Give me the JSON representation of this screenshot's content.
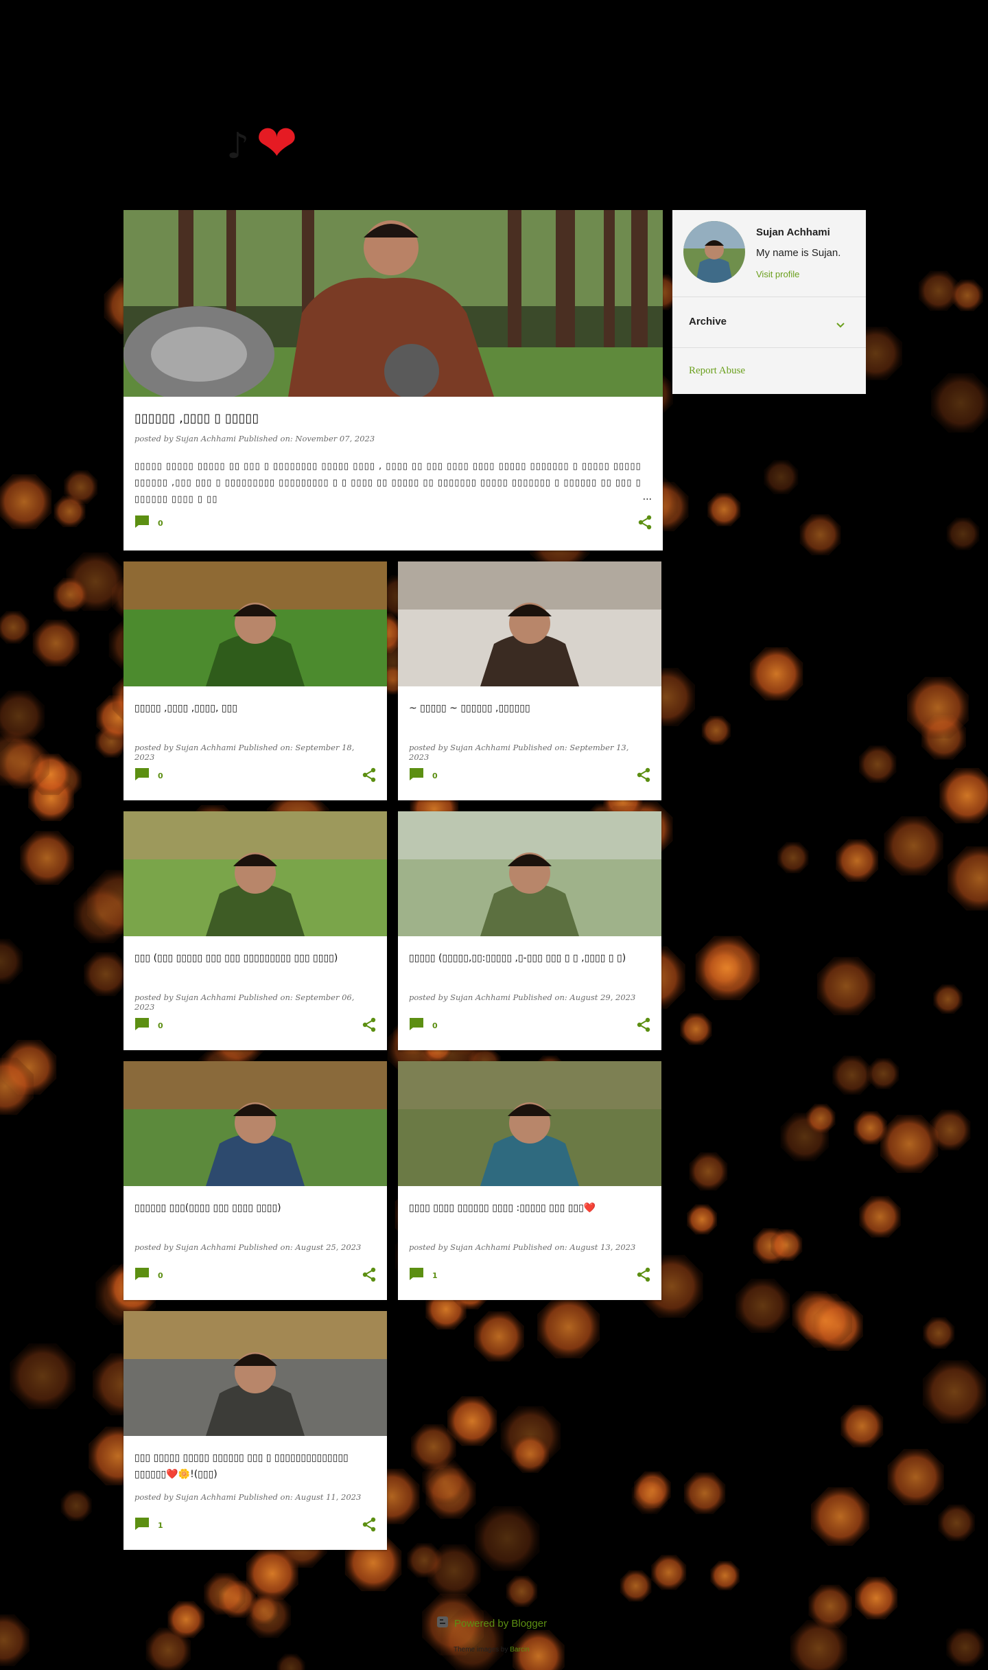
{
  "blog": {
    "title_icon": "heart-emoji",
    "title_text": "♪",
    "heart": "❤"
  },
  "colors": {
    "accent": "#6a9f1c",
    "link": "#5c8f12",
    "card_bg": "#ffffff",
    "page_bg": "#000000",
    "bokeh": "#e8731f"
  },
  "featured": {
    "title": "▯▯▯▯▯▯ ,▯▯▯▯ ▯ ▯▯▯▯▯",
    "meta": "posted by Sujan Achhami Published on: November 07, 2023",
    "excerpt": "▯▯▯▯▯ ▯▯▯▯▯ ▯▯▯▯▯ ▯▯ ▯▯▯ ▯ ▯▯▯▯▯▯▯▯ ▯▯▯▯▯ ▯▯▯▯ , ▯▯▯▯ ▯▯ ▯▯▯ ▯▯▯▯ ▯▯▯▯ ▯▯▯▯▯ ▯▯▯▯▯▯▯ ▯ ▯▯▯▯▯ ▯▯▯▯▯ ▯▯▯▯▯▯ ,▯▯▯ ▯▯▯ ▯ ▯▯▯▯▯▯▯▯▯ ▯▯▯▯▯▯▯▯▯ ▯ ▯ ▯▯▯▯ ▯▯ ▯▯▯▯▯ ▯▯ ▯▯▯▯▯▯▯ ▯▯▯▯▯ ▯▯▯▯▯▯▯ ▯ ▯▯▯▯▯▯ ▯▯ ▯▯▯ ▯ ▯▯▯▯▯▯ ▯▯▯▯ ▯ ▯▯",
    "more": "...",
    "comments": "0"
  },
  "posts": [
    {
      "title": "▯▯▯▯▯ ,▯▯▯▯ ,▯▯▯▯, ▯▯▯",
      "meta": "posted by Sujan Achhami Published on: September 18, 2023",
      "comments": "0"
    },
    {
      "title": "~ ▯▯▯▯▯ ~ ▯▯▯▯▯▯ ,▯▯▯▯▯▯",
      "meta": "posted by Sujan Achhami Published on: September 13, 2023",
      "comments": "0"
    },
    {
      "title": "▯▯▯ (▯▯▯ ▯▯▯▯▯ ▯▯▯ ▯▯▯ ▯▯▯▯▯▯▯▯▯ ▯▯▯ ▯▯▯▯)",
      "meta": "posted by Sujan Achhami Published on: September 06, 2023",
      "comments": "0"
    },
    {
      "title": "▯▯▯▯▯ (▯▯▯▯▯,▯▯:▯▯▯▯▯ ,▯-▯▯▯ ▯▯▯ ▯ ▯ ,▯▯▯▯ ▯ ▯)",
      "meta": "posted by Sujan Achhami Published on: August 29, 2023",
      "comments": "0"
    },
    {
      "title": "▯▯▯▯▯▯ ▯▯▯(▯▯▯▯ ▯▯▯ ▯▯▯▯ ▯▯▯▯)",
      "meta": "posted by Sujan Achhami Published on: August 25, 2023",
      "comments": "0"
    },
    {
      "title": "▯▯▯▯ ▯▯▯▯ ▯▯▯▯▯▯ ▯▯▯▯ :▯▯▯▯▯ ▯▯▯ ▯▯▯❤️",
      "meta": "posted by Sujan Achhami Published on: August 13, 2023",
      "comments": "1"
    },
    {
      "title": "▯▯▯ ▯▯▯▯▯ ▯▯▯▯▯ ▯▯▯▯▯▯ ▯▯▯ ▯ ▯▯▯▯▯▯▯▯▯▯▯▯▯▯ ▯▯▯▯▯▯❤️🌼!(▯▯▯)",
      "meta": "posted by Sujan Achhami Published on: August 11, 2023",
      "comments": "1"
    }
  ],
  "sidebar": {
    "name": "Sujan Achhami",
    "about": "My name is Sujan.",
    "visit": "Visit profile",
    "archive": "Archive",
    "report": "Report Abuse"
  },
  "footer": {
    "powered": "Powered by Blogger",
    "theme_prefix": "Theme images by",
    "theme_author": "Barcin"
  }
}
